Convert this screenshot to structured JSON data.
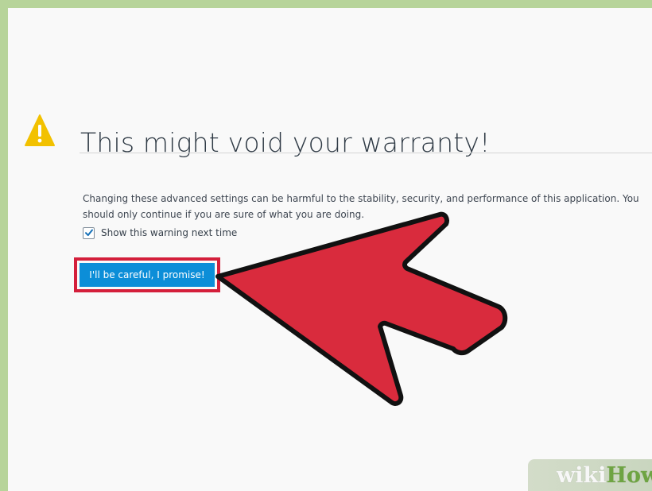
{
  "dialog": {
    "title": "This might void your warranty!",
    "description": "Changing these advanced settings can be harmful to the stability, security, and performance of this application. You should only continue if you are sure of what you are doing.",
    "checkbox_label": "Show this warning next time",
    "checkbox_checked": true,
    "button_label": "I'll be careful, I promise!"
  },
  "annotation": {
    "highlight_color": "#d41f3b",
    "arrow_color": "#d92b3d"
  },
  "watermark": {
    "wiki": "wiki",
    "how": "How"
  },
  "colors": {
    "frame_border": "#b7d49a",
    "title": "#2f3a45",
    "button": "#0c8ed8",
    "warning_icon": "#f2c100"
  }
}
